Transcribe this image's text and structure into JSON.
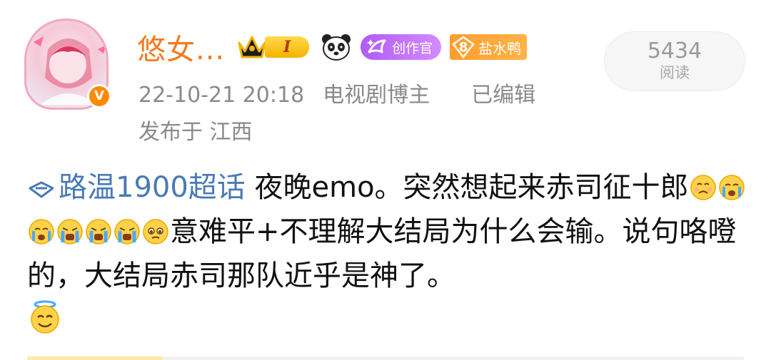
{
  "user": {
    "name": "悠女...",
    "vip_level_label": "I",
    "creator_badge": "创作官",
    "fan_badge_level": "8",
    "fan_badge_name": "盐水鸭"
  },
  "reads": {
    "count": "5434",
    "label": "阅读"
  },
  "meta": {
    "timestamp": "22-10-21 20:18",
    "role": "电视剧博主",
    "edited": "已编辑",
    "location": "发布于 江西"
  },
  "post": {
    "topic": "路温1900超话",
    "text_part1": " 夜晚emo。突然想起来赤司征十郎",
    "text_part2": "意难平+不理解大结局为什么会输。说句咯噔的，大结局赤司那队近乎是神了。"
  },
  "icons": {
    "verified": "verified-v-icon",
    "crown": "crown-icon",
    "panda": "panda-icon",
    "creator": "creator-sparkle-icon",
    "topic": "diamond-topic-icon"
  },
  "colors": {
    "username": "#f37a1f",
    "topic": "#4a7ab3",
    "creator_badge": "#b05cf5",
    "fan_badge": "#ff9d2e",
    "verified": "#ff8a00"
  }
}
